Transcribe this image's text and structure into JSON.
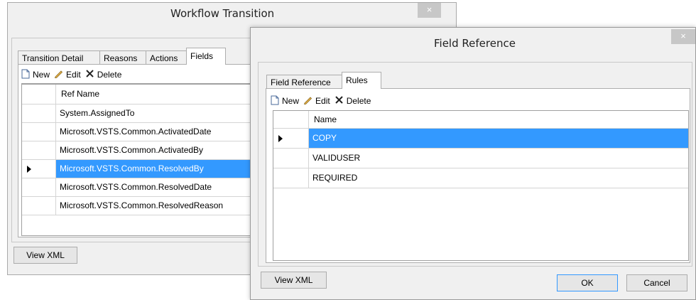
{
  "workflow_dialog": {
    "title": "Workflow Transition",
    "close_glyph": "×",
    "tabs": [
      "Transition Detail",
      "Reasons",
      "Actions",
      "Fields"
    ],
    "active_tab": "Fields",
    "toolbar": {
      "new_label": "New",
      "edit_label": "Edit",
      "delete_label": "Delete"
    },
    "grid": {
      "column_header": "Ref Name",
      "rows": [
        "System.AssignedTo",
        "Microsoft.VSTS.Common.ActivatedDate",
        "Microsoft.VSTS.Common.ActivatedBy",
        "Microsoft.VSTS.Common.ResolvedBy",
        "Microsoft.VSTS.Common.ResolvedDate",
        "Microsoft.VSTS.Common.ResolvedReason"
      ],
      "selected_row": 3
    },
    "view_xml_label": "View XML"
  },
  "field_reference_dialog": {
    "title": "Field Reference",
    "close_glyph": "×",
    "tabs": [
      "Field Reference",
      "Rules"
    ],
    "active_tab": "Rules",
    "toolbar": {
      "new_label": "New",
      "edit_label": "Edit",
      "delete_label": "Delete"
    },
    "grid": {
      "column_header": "Name",
      "rows": [
        "COPY",
        "VALIDUSER",
        "REQUIRED"
      ],
      "selected_row": 0
    },
    "view_xml_label": "View XML",
    "ok_label": "OK",
    "cancel_label": "Cancel"
  },
  "colors": {
    "selection": "#3399ff",
    "window_bg": "#f0f0f0",
    "close_button": "#c7c7c7"
  },
  "icons": [
    "new-document-icon",
    "pencil-edit-icon",
    "delete-x-icon",
    "row-pointer-icon"
  ]
}
